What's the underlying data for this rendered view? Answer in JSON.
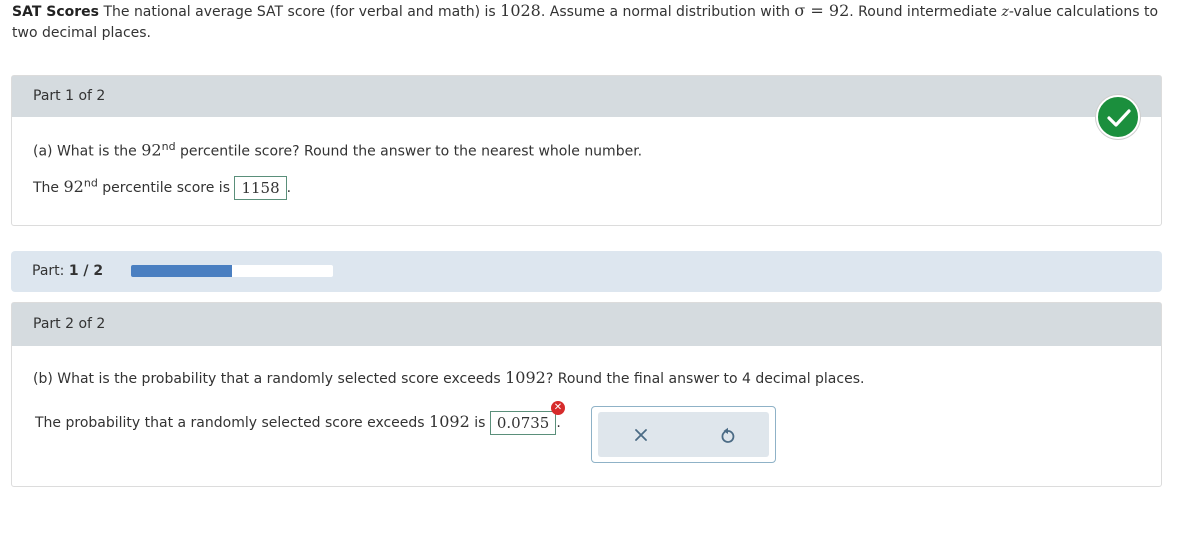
{
  "problem": {
    "title": "SAT Scores",
    "text_1": " The national average SAT score (for verbal and math) is ",
    "mean": "1028",
    "text_2": ". Assume a normal distribution with ",
    "sigma": "σ = 92",
    "text_3": ". Round intermediate ",
    "z": "z",
    "text_4": "-value calculations to two decimal places."
  },
  "part1": {
    "header": "Part 1 of 2",
    "q_prefix": "(a) What is the ",
    "pct_num": "92",
    "pct_sup": "nd",
    "q_suffix": " percentile score? Round the answer to the nearest whole number.",
    "ans_prefix": "The ",
    "ans_mid": " percentile score is ",
    "answer": "1158",
    "ans_end": ".",
    "status": "correct"
  },
  "progress": {
    "label": "Part: ",
    "value": "1 / 2",
    "fraction": 0.5,
    "fill_color": "#4a7fc1"
  },
  "part2": {
    "header": "Part 2 of 2",
    "q_prefix": "(b) What is the probability that a randomly selected score exceeds ",
    "q_value": "1092",
    "q_suffix": "? Round the final answer to 4 decimal places.",
    "ans_prefix": "The probability that a randomly selected score exceeds ",
    "ans_value": "1092",
    "ans_mid": " is ",
    "answer": "0.0735",
    "ans_end": ".",
    "status": "incorrect"
  },
  "tools": {
    "clear_icon": "close-icon",
    "undo_icon": "undo-icon"
  },
  "colors": {
    "correct": "#1b8f3d",
    "incorrect": "#d62b2b"
  }
}
